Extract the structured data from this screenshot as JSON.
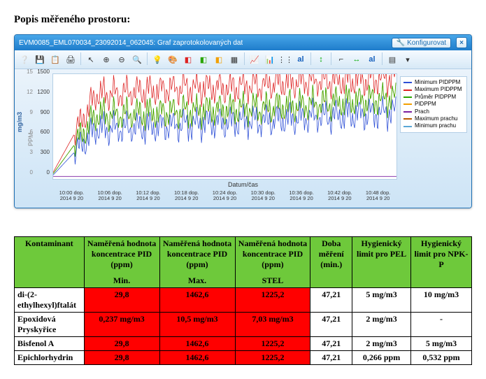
{
  "heading": "Popis měřeného prostoru:",
  "chart": {
    "window_title": "EVM0085_EML070034_23092014_062045: Graf zaprotokolovaných dat",
    "config_button": "Konfigurovat",
    "y_label_left": "mg/m3",
    "y_label_left2": "PPM",
    "x_label": "Datum/čas",
    "y_ticks_left": [
      "1500",
      "1200",
      "900",
      "600",
      "300",
      "0"
    ],
    "y_ticks_left2": [
      "15",
      "12",
      "9",
      "6",
      "3",
      "0"
    ],
    "x_ticks": [
      {
        "t": "10:00 dop.",
        "d": "2014 9 20"
      },
      {
        "t": "10:06 dop.",
        "d": "2014 9 20"
      },
      {
        "t": "10:12 dop.",
        "d": "2014 9 20"
      },
      {
        "t": "10:18 dop.",
        "d": "2014 9 20"
      },
      {
        "t": "10:24 dop.",
        "d": "2014 9 20"
      },
      {
        "t": "10:30 dop.",
        "d": "2014 9 20"
      },
      {
        "t": "10:36 dop.",
        "d": "2014 9 20"
      },
      {
        "t": "10:42 dop.",
        "d": "2014 9 20"
      },
      {
        "t": "10:48 dop.",
        "d": "2014 9 20"
      }
    ],
    "legend": [
      {
        "label": "Minimum PIDPPM",
        "color": "#2d4fd6"
      },
      {
        "label": "Maximum PIDPPM",
        "color": "#d22"
      },
      {
        "label": "Průměr PIDPPM",
        "color": "#2aa502"
      },
      {
        "label": "PIDPPM",
        "color": "#f2a000"
      },
      {
        "label": "Prach",
        "color": "#7a1fa0"
      },
      {
        "label": "Maximum prachu",
        "color": "#b85c00"
      },
      {
        "label": "Minimum prachu",
        "color": "#5aa7d6"
      }
    ]
  },
  "table": {
    "headers": {
      "c1": "Kontaminant",
      "c2": "Naměřená hodnota koncentrace PID (ppm)",
      "c3": "Naměřená hodnota koncentrace PID (ppm)",
      "c4": "Naměřená hodnota koncentrace PID (ppm)",
      "c5": "Doba měření (min.)",
      "c6": "Hygienický limit pro PEL",
      "c7": "Hygienický limit pro NPK-P",
      "s2": "Min.",
      "s3": "Max.",
      "s4": "STEL"
    },
    "rows": [
      {
        "name": "di-(2-ethylhexyl)ftalát",
        "min": "29,8",
        "max": "1462,6",
        "stel": "1225,2",
        "dur": "47,21",
        "pel": "5 mg/m3",
        "npk": "10 mg/m3"
      },
      {
        "name": "Epoxidová Pryskyřice",
        "min": "0,237 mg/m3",
        "max": "10,5 mg/m3",
        "stel": "7,03 mg/m3",
        "dur": "47,21",
        "pel": "2 mg/m3",
        "npk": "-"
      },
      {
        "name": "Bisfenol A",
        "min": "29,8",
        "max": "1462,6",
        "stel": "1225,2",
        "dur": "47,21",
        "pel": "2 mg/m3",
        "npk": "5 mg/m3"
      },
      {
        "name": "Epichlorhydrin",
        "min": "29,8",
        "max": "1462,6",
        "stel": "1225,2",
        "dur": "47,21",
        "pel": "0,266 ppm",
        "npk": "0,532 ppm"
      }
    ]
  },
  "chart_data": {
    "type": "line",
    "title": "Graf zaprotokolovaných dat",
    "xlabel": "Datum/čas",
    "ylabel_left": "mg/m3",
    "ylabel_left2": "PPM",
    "ylim_left": [
      0,
      1500
    ],
    "ylim_left2": [
      0,
      15
    ],
    "x": [
      "10:00",
      "10:06",
      "10:12",
      "10:18",
      "10:24",
      "10:30",
      "10:36",
      "10:42",
      "10:48"
    ],
    "date": "2014-09-20",
    "series": [
      {
        "name": "PIDPPM",
        "axis": "PPM",
        "color": "#f2a000",
        "approx_values": [
          50,
          900,
          920,
          950,
          980,
          1000,
          1050,
          1100,
          1150
        ]
      },
      {
        "name": "Minimum PIDPPM",
        "axis": "PPM",
        "color": "#2d4fd6",
        "approx_values": [
          30,
          700,
          720,
          760,
          800,
          820,
          870,
          900,
          950
        ]
      },
      {
        "name": "Maximum PIDPPM",
        "axis": "PPM",
        "color": "#d22",
        "approx_values": [
          70,
          1200,
          1250,
          1300,
          1300,
          1350,
          1400,
          1400,
          1450
        ]
      },
      {
        "name": "Průměr PIDPPM",
        "axis": "PPM",
        "color": "#2aa502",
        "approx_values": [
          50,
          900,
          930,
          960,
          990,
          1010,
          1060,
          1100,
          1150
        ]
      },
      {
        "name": "Prach",
        "axis": "mg/m3",
        "color": "#7a1fa0",
        "approx_values": [
          0,
          0,
          0,
          0,
          0,
          0,
          0,
          0,
          0
        ]
      },
      {
        "name": "Maximum prachu",
        "axis": "mg/m3",
        "color": "#b85c00",
        "approx_values": [
          0,
          0,
          0,
          0,
          0,
          0,
          0,
          0,
          0
        ]
      },
      {
        "name": "Minimum prachu",
        "axis": "mg/m3",
        "color": "#5aa7d6",
        "approx_values": [
          0,
          0,
          0,
          0,
          0,
          0,
          0,
          0,
          0
        ]
      }
    ],
    "note": "Values are approximate readings from chart pixels; exact samples not labeled."
  }
}
